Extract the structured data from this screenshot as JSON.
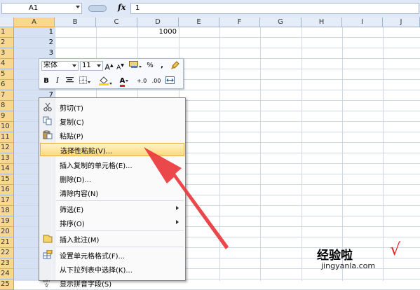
{
  "formula_bar": {
    "name_box": "A1",
    "fx": "fx",
    "formula_value": "1"
  },
  "columns": [
    "A",
    "B",
    "C",
    "D",
    "E",
    "F",
    "G",
    "H",
    "I",
    "J"
  ],
  "rows": [
    "1",
    "2",
    "3",
    "4",
    "5",
    "6",
    "7",
    "8",
    "9",
    "10",
    "11",
    "12",
    "13",
    "14",
    "15",
    "16",
    "17",
    "18",
    "19",
    "20",
    "21",
    "22",
    "23",
    "24",
    "25"
  ],
  "cells": {
    "A1": "1",
    "A2": "2",
    "A3": "3",
    "A7": "7",
    "D1": "1000"
  },
  "mini_toolbar": {
    "font_name": "宋体",
    "font_size": "11",
    "grow_font": "A",
    "shrink_font": "A",
    "percent": "%",
    "comma": ",",
    "bold": "B",
    "italic": "I",
    "font_color": "A",
    "inc_decimal": "+.0",
    "dec_decimal": ".00"
  },
  "context_menu": {
    "cut": "剪切(T)",
    "copy": "复制(C)",
    "paste": "粘贴(P)",
    "paste_special": "选择性粘贴(V)...",
    "insert_copied": "插入复制的单元格(E)...",
    "delete": "删除(D)...",
    "clear_contents": "清除内容(N)",
    "filter": "筛选(E)",
    "sort": "排序(O)",
    "insert_comment": "插入批注(M)",
    "format_cells": "设置单元格格式(F)...",
    "pick_from_list": "从下拉列表中选择(K)...",
    "show_phonetic": "显示拼音字段(S)"
  },
  "watermark": {
    "brand": "经验啦",
    "check": "√",
    "url": "jingyanla.com"
  },
  "colors": {
    "header_bg": "#e4ecf7",
    "selected_header": "#f8d890",
    "highlight": "#ffd978",
    "arrow": "#e8383b"
  }
}
